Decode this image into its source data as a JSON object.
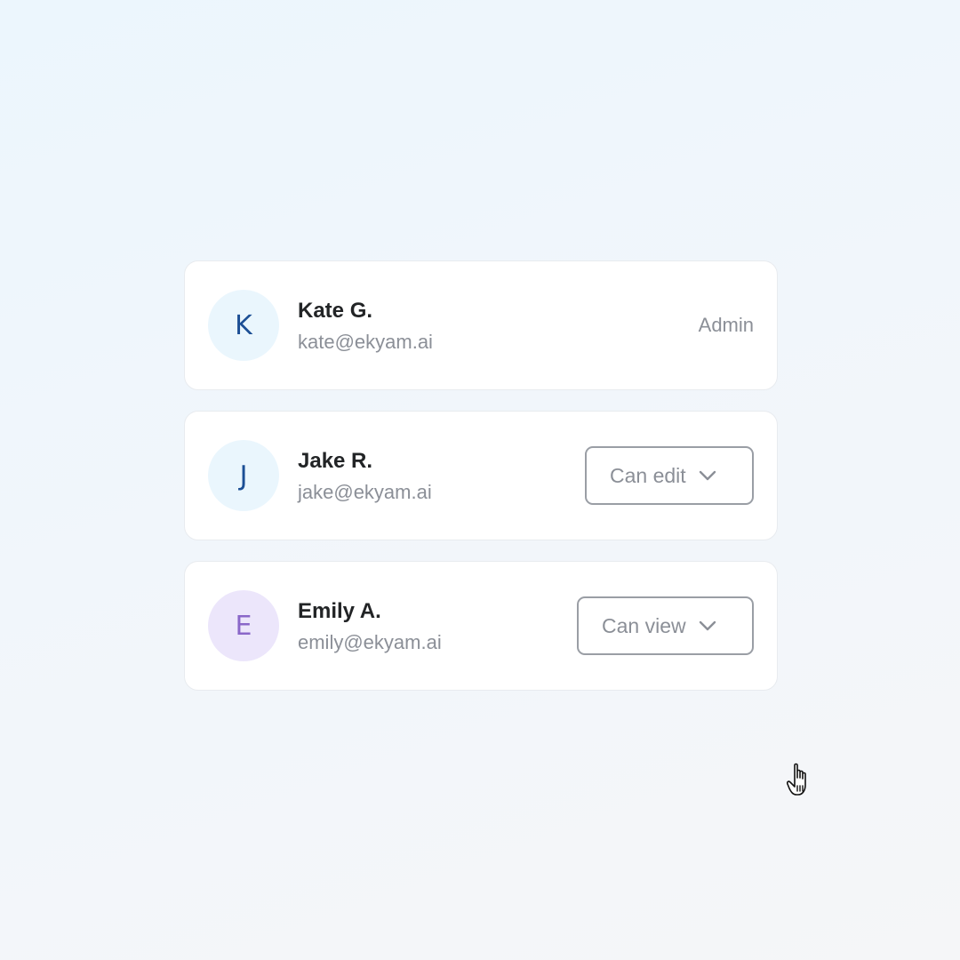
{
  "colors": {
    "avatar_blue_bg": "#eaf6fd",
    "avatar_blue_text": "#1c4f95",
    "avatar_purple_bg": "#ece6fb",
    "avatar_purple_text": "#8a67c9"
  },
  "members": [
    {
      "initial": "K",
      "name": "Kate G.",
      "email": "kate@ekyam.ai",
      "role": "Admin"
    },
    {
      "initial": "J",
      "name": "Jake R.",
      "email": "jake@ekyam.ai",
      "role": "Can edit",
      "role_icon": "chevron-down-icon"
    },
    {
      "initial": "E",
      "name": "Emily A.",
      "email": "emily@ekyam.ai",
      "role": "Can view",
      "role_icon": "chevron-down-icon"
    }
  ],
  "cursor": {
    "icon": "hand-pointer-icon"
  }
}
